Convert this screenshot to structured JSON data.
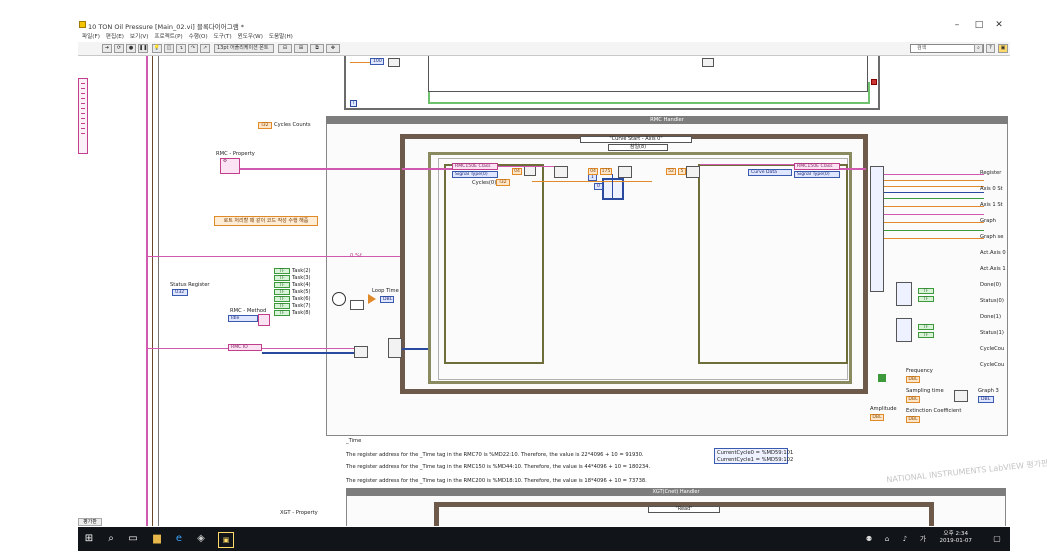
{
  "window": {
    "title": "10 TON Oil Pressure [Main_02.vi] 블록다이어그램 *",
    "minimize": "–",
    "maximize": "□",
    "close": "✕"
  },
  "menu": [
    "파일(F)",
    "편집(E)",
    "보기(V)",
    "프로젝트(P)",
    "수행(O)",
    "도구(T)",
    "윈도우(W)",
    "도움말(H)"
  ],
  "toolbar": {
    "font_select": "13pt 어플리케이션 폰트",
    "search_placeholder": "검색",
    "help": "?"
  },
  "diagram": {
    "top_const": "100",
    "cycles_counts": "Cycles Counts",
    "rmc_property": "RMC - Property",
    "comment_korean": "로트 처리할 때 같이 코드 작성 수행 해줌",
    "wait_string": "0.%f",
    "status_register": "Status Register",
    "rmc_method": "RMC - Method",
    "idle": "Idle",
    "rmc_ctrl": "RMC IO",
    "loop_time": "Loop Time",
    "tasks": [
      "Task(2)",
      "Task(3)",
      "Task(4)",
      "Task(5)",
      "Task(6)",
      "Task(7)",
      "Task(8)"
    ],
    "rmc_handler": "RMC Handler",
    "case_selector": "\"Curve Start - Axis 0\"",
    "inner_selector": "참일(8)",
    "rmc_class_left": "RMC150E Class",
    "signal_type_left": "Signal Type(0)",
    "cycles": "Cycles(0)",
    "const_04": "04",
    "const_1": "1",
    "const_0": "0",
    "const_175": "175",
    "const_52": "52",
    "const_5": "5",
    "curve_data": "Curve Data",
    "rmc_class_right": "RMC150E Class",
    "signal_type_right": "Signal Type(0)",
    "outputs": [
      "Register",
      "Axis 0 St",
      "Axis 1 St",
      "Graph",
      "Graph se",
      "Act.Axis 0",
      "Act.Axis 1",
      "Done(0)",
      "Status(0)",
      "Done(1)",
      "Status(1)",
      "CycleCou",
      "CycleCou"
    ],
    "frequency": "Frequency",
    "sampling_time": "Sampling time",
    "amplitude": "Amplitude",
    "extinction": "Extinction Coefficient",
    "graph_out": "Graph 3",
    "time_label": "_Time",
    "note_1": "The register address for the _Time tag in the RMC70 is %MD22:10. Therefore, the value is 22*4096 + 10 = 91930.",
    "note_2": "The register address for the _Time tag in the RMC150 is %MD44:10. Therefore, the value is 44*4096 + 10 = 180234.",
    "note_3": "The register address for the _Time tag in the RMC200 is %MD18:10. Therefore, the value is 18*4096 + 10 = 73738.",
    "current_cycle_0": "CurrentCycle0 = %MD59:101",
    "current_cycle_1": "CurrentCycle1 = %MD59:102",
    "xgt_property": "XGT - Property",
    "xgt_handler": "XGT(Cnet) Handler",
    "read": "\"Read\"",
    "watermark": "NATIONAL INSTRUMENTS LabVIEW 평가판"
  },
  "statusbar": {
    "left": "평가판"
  },
  "taskbar": {
    "time": "오후 2:34",
    "date": "2019-01-07"
  },
  "colors": {
    "cluster_wire": "#d05ab0",
    "numeric_wire": "#e08a2a",
    "refnum_wire": "#2a4aa0",
    "boolean_wire": "#3c9a3c",
    "frame": "#6e5a4a",
    "taskbar": "#111418"
  }
}
